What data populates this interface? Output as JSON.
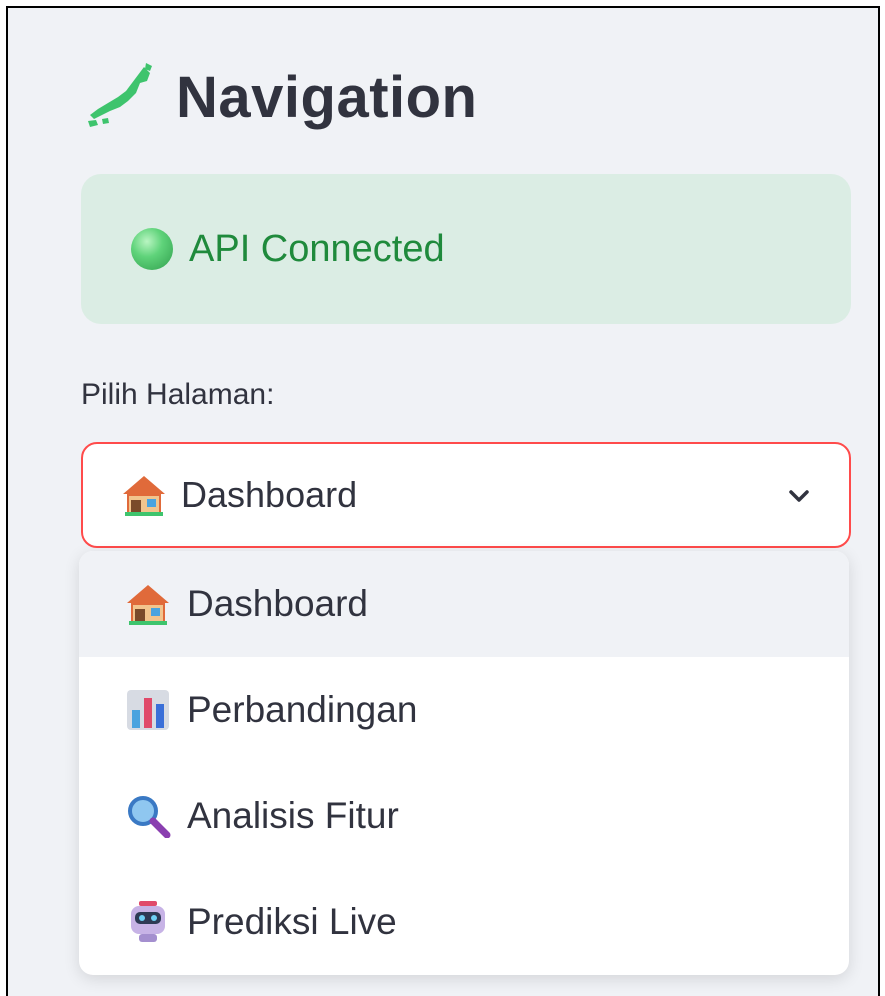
{
  "sidebar": {
    "title": "Navigation",
    "title_icon": "japan-map-icon",
    "status": {
      "text": "API Connected",
      "color": "#1f8a3c",
      "background": "#dbede4",
      "icon": "green-circle-icon"
    },
    "page_select": {
      "label": "Pilih Halaman:",
      "selected_value": "Dashboard",
      "selected_icon": "house-icon",
      "border_color": "#ff4b4b",
      "options": [
        {
          "label": "Dashboard",
          "icon": "house-icon",
          "selected": true
        },
        {
          "label": "Perbandingan",
          "icon": "bar-chart-icon",
          "selected": false
        },
        {
          "label": "Analisis Fitur",
          "icon": "magnifier-icon",
          "selected": false
        },
        {
          "label": "Prediksi Live",
          "icon": "robot-icon",
          "selected": false
        }
      ]
    }
  }
}
